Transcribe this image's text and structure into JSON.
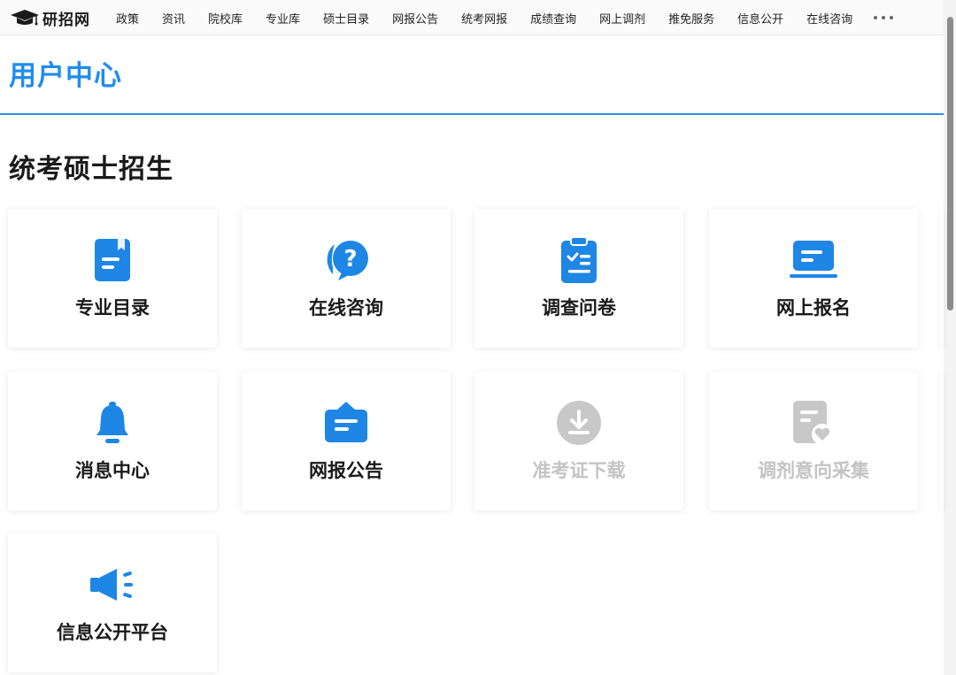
{
  "header": {
    "logo_text": "研招网",
    "nav_items": [
      "政策",
      "资讯",
      "院校库",
      "专业库",
      "硕士目录",
      "网报公告",
      "统考网报",
      "成绩查询",
      "网上调剂",
      "推免服务",
      "信息公开",
      "在线咨询"
    ]
  },
  "page": {
    "title": "用户中心",
    "section_title": "统考硕士招生"
  },
  "cards": [
    {
      "label": "专业目录",
      "icon": "catalog-icon",
      "enabled": true
    },
    {
      "label": "在线咨询",
      "icon": "consult-icon",
      "enabled": true
    },
    {
      "label": "调查问卷",
      "icon": "survey-icon",
      "enabled": true
    },
    {
      "label": "网上报名",
      "icon": "registration-icon",
      "enabled": true
    },
    {
      "label": "消息中心",
      "icon": "bell-icon",
      "enabled": true
    },
    {
      "label": "网报公告",
      "icon": "announcement-icon",
      "enabled": true
    },
    {
      "label": "准考证下载",
      "icon": "download-icon",
      "enabled": false
    },
    {
      "label": "调剂意向采集",
      "icon": "adjustment-icon",
      "enabled": false
    },
    {
      "label": "信息公开平台",
      "icon": "megaphone-icon",
      "enabled": true
    }
  ],
  "colors": {
    "accent": "#1f8ded",
    "icon_blue": "#1e86e5",
    "disabled": "#c8c8c8"
  }
}
